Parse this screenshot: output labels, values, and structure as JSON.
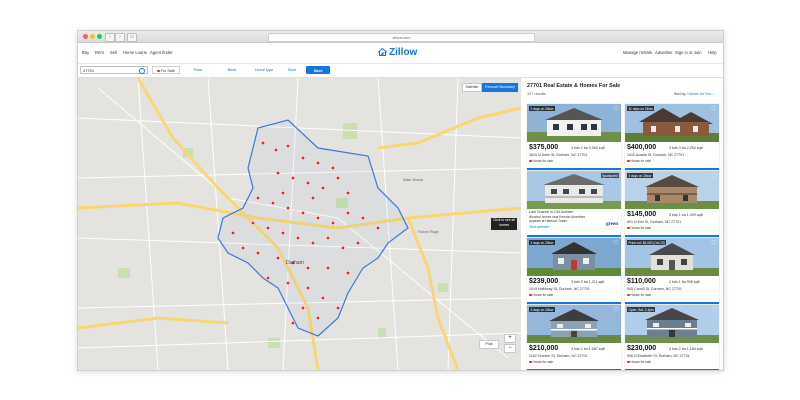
{
  "browser": {
    "url": "zillow.com",
    "back_icon": "‹",
    "forward_icon": "›",
    "sidebar_icon": "▭"
  },
  "nav": {
    "left": [
      "Buy",
      "Rent",
      "Sell",
      "Home Loans",
      "Agent finder"
    ],
    "right": [
      "Manage rentals",
      "Advertise",
      "Sign in or Join",
      "Help"
    ],
    "logo": "Zillow"
  },
  "filters": {
    "search_value": "27701",
    "for_sale": "For Sale",
    "price": "Price",
    "beds": "Beds",
    "home_type": "Home type",
    "more": "More",
    "save_search": "Save search"
  },
  "map": {
    "satellite": "Satellite",
    "remove_boundary": "Remove Boundary",
    "city_label": "Durham",
    "draw_label": "Click to see all homes",
    "plus_label": "Plus",
    "zoom_in": "+",
    "zoom_out": "−",
    "street_labels": [
      "Milan Woods",
      "Falcon Ridge"
    ],
    "colors": {
      "land": "#e5e3df",
      "park": "#c9dfb2",
      "highway": "#f7d774",
      "road": "#ffffff",
      "boundary": "#3c78d8",
      "pin": "#e42a23"
    }
  },
  "results": {
    "title": "27701 Real Estate & Homes For Sale",
    "count": "157 results",
    "sort_label": "Sort by:",
    "sort_value": "Homes for You ⌄",
    "ad": {
      "sponsored": "Sponsored",
      "line1": "Last Chance in Old Durham",
      "line2": "Wooded homes near Keenan Amenities",
      "line3": "Appears at Harrison Tracts",
      "link": "Visit website ›",
      "logo": "green"
    },
    "listings": [
      {
        "badge": "3 days on Zillow",
        "price": "$375,000",
        "specs": "3 bds  2 ba  2,063 sqft",
        "address": "1615 N Duke St, Durham, NC 27701",
        "status": "House for sale"
      },
      {
        "badge": "11 days on Zillow",
        "price": "$400,000",
        "specs": "3 bds  3 ba  2,254 sqft",
        "address": "1410 Acadia St, Durham, NC 27701",
        "status": "House for sale"
      },
      {
        "badge": "4 days on Zillow",
        "price": "$145,000",
        "specs": "3 bds  1 ba  1,099 sqft",
        "address": "801 N Elm St, Durham, NC 27701",
        "status": "House for sale"
      },
      {
        "badge": "3 days on Zillow",
        "price": "$239,000",
        "specs": "3 bds  2 ba  1,211 sqft",
        "address": "1019 Holloway St, Durham, NC 27701",
        "status": "House for sale"
      },
      {
        "badge": "Price cut: $5,000 (Oct 23)",
        "price": "$110,000",
        "specs": "2 bds  1 ba  906 sqft",
        "address": "905 Carroll St, Durham, NC 27701",
        "status": "House for sale"
      },
      {
        "badge": "3 days on Zillow",
        "price": "$210,000",
        "specs": "3 bds  2 ba  1,087 sqft",
        "address": "1162 Chester St, Durham, NC 27701",
        "status": "House for sale"
      },
      {
        "badge": "Open: Sat. 2-4pm",
        "price": "$230,000",
        "specs": "3 bds  2 ba  1,184 sqft",
        "address": "906 N Elizabeth St, Durham, NC 27701",
        "status": "House for sale"
      }
    ]
  }
}
